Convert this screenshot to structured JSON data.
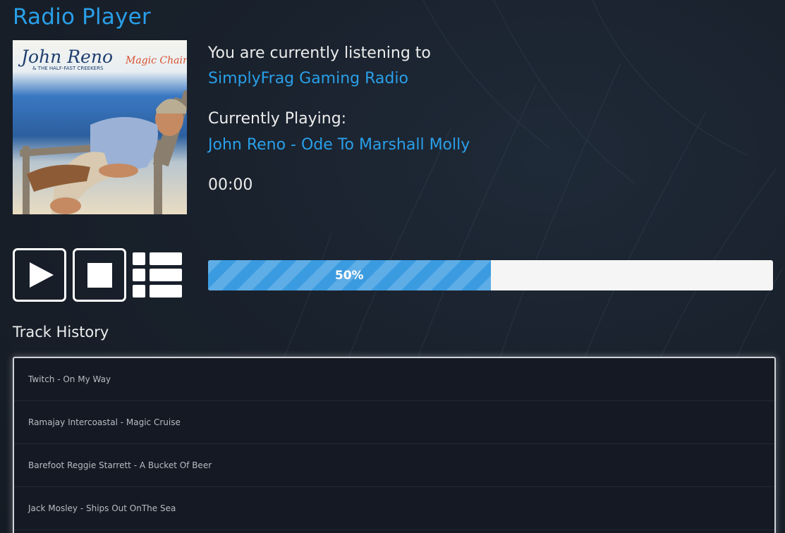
{
  "page": {
    "title": "Radio Player"
  },
  "album_art": {
    "artist_text": "John Reno",
    "band_text": "& THE HALF-FAST CREEKERS",
    "album_text": "Magic Chair"
  },
  "now_playing": {
    "listening_label": "You are currently listening to",
    "station_name": "SimplyFrag Gaming Radio",
    "playing_label": "Currently Playing:",
    "track": "John Reno - Ode To Marshall Molly",
    "elapsed": "00:00"
  },
  "controls": {
    "play_icon": "play-icon",
    "stop_icon": "stop-icon",
    "list_icon": "list-icon"
  },
  "progress": {
    "percent": 50,
    "label": "50%"
  },
  "history": {
    "title": "Track History",
    "items": [
      "Twitch - On My Way",
      "Ramajay Intercoastal - Magic Cruise",
      "Barefoot Reggie Starrett - A Bucket Of Beer",
      "Jack Mosley - Ships Out OnThe Sea"
    ]
  },
  "colors": {
    "accent": "#2a9fe9",
    "background": "#19212c",
    "progress_fill": "#3b9be0",
    "progress_track": "#f5f5f5"
  }
}
